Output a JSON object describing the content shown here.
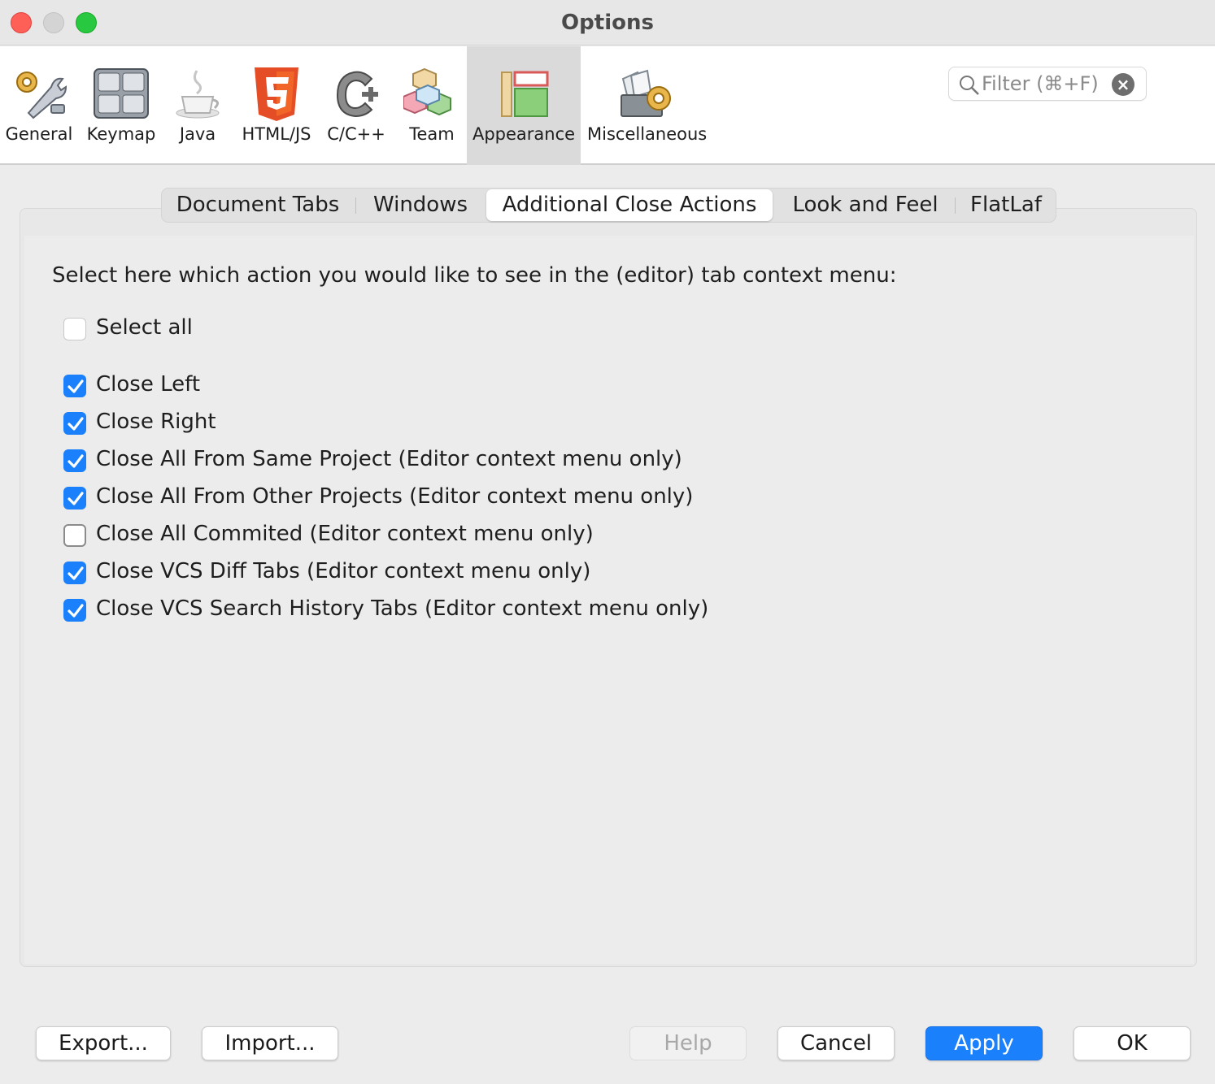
{
  "window": {
    "title": "Options"
  },
  "toolbar": {
    "items": [
      {
        "label": "General",
        "icon": "general-gear-wrench-icon"
      },
      {
        "label": "Keymap",
        "icon": "keyboard-icon"
      },
      {
        "label": "Java",
        "icon": "java-cup-icon"
      },
      {
        "label": "HTML/JS",
        "icon": "html5-icon"
      },
      {
        "label": "C/C++",
        "icon": "cpp-icon"
      },
      {
        "label": "Team",
        "icon": "team-cubes-icon"
      },
      {
        "label": "Appearance",
        "icon": "appearance-layout-icon",
        "selected": true
      },
      {
        "label": "Miscellaneous",
        "icon": "misc-folder-gear-icon"
      }
    ],
    "filter_placeholder": "Filter (⌘+F)"
  },
  "tabs": [
    {
      "label": "Document Tabs"
    },
    {
      "label": "Windows"
    },
    {
      "label": "Additional Close Actions",
      "active": true
    },
    {
      "label": "Look and Feel"
    },
    {
      "label": "FlatLaf"
    }
  ],
  "content": {
    "prompt": "Select here which action you would like to see in the (editor) tab context menu:",
    "select_all": {
      "label": "Select all",
      "checked": false
    },
    "options": [
      {
        "label": "Close Left",
        "checked": true
      },
      {
        "label": "Close Right",
        "checked": true
      },
      {
        "label": "Close All From Same Project (Editor context menu only)",
        "checked": true
      },
      {
        "label": "Close All From Other Projects (Editor context menu only)",
        "checked": true
      },
      {
        "label": "Close All Commited (Editor context menu only)",
        "checked": false
      },
      {
        "label": "Close VCS Diff Tabs (Editor context menu only)",
        "checked": true
      },
      {
        "label": "Close VCS Search History Tabs (Editor context menu only)",
        "checked": true
      }
    ]
  },
  "buttons": {
    "export": "Export...",
    "import": "Import...",
    "help": "Help",
    "cancel": "Cancel",
    "apply": "Apply",
    "ok": "OK"
  },
  "colors": {
    "accent": "#1a80fb",
    "selected_tool_bg": "#dadada"
  }
}
